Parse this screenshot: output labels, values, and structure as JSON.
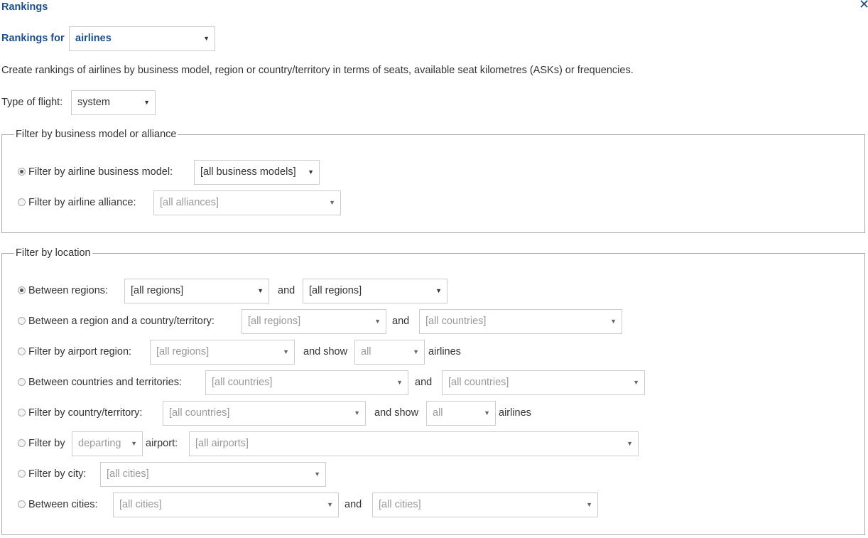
{
  "dialog": {
    "title": "Rankings",
    "close_glyph": "✕"
  },
  "rankings_for": {
    "label": "Rankings for",
    "value": "airlines"
  },
  "description": "Create rankings of airlines by business model, region or country/territory in terms of seats, available seat kilometres (ASKs) or frequencies.",
  "flight_type": {
    "label": "Type of flight:",
    "value": "system"
  },
  "business_filter": {
    "legend": "Filter by business model or alliance",
    "rows": [
      {
        "label": "Filter by airline business model:",
        "select": "[all business models]",
        "selected": true
      },
      {
        "label": "Filter by airline alliance:",
        "select": "[all alliances]",
        "selected": false
      }
    ]
  },
  "location_filter": {
    "legend": "Filter by location",
    "between_regions": {
      "label": "Between regions:",
      "select1": "[all regions]",
      "and": "and",
      "select2": "[all regions]",
      "selected": true
    },
    "region_country": {
      "label": "Between a region and a country/territory:",
      "select1": "[all regions]",
      "and": "and",
      "select2": "[all countries]"
    },
    "airport_region": {
      "label": "Filter by airport region:",
      "select1": "[all regions]",
      "and_show": "and show",
      "select2": "all",
      "suffix": "airlines"
    },
    "between_countries": {
      "label": "Between countries and territories:",
      "select1": "[all countries]",
      "and": "and",
      "select2": "[all countries]"
    },
    "country": {
      "label": "Filter by country/territory:",
      "select1": "[all countries]",
      "and_show": "and show",
      "select2": "all",
      "suffix": "airlines"
    },
    "airport": {
      "label": "Filter by",
      "direction": "departing",
      "airport_label": "airport:",
      "select": "[all airports]"
    },
    "city": {
      "label": "Filter by city:",
      "select": "[all cities]"
    },
    "between_cities": {
      "label": "Between cities:",
      "select1": "[all cities]",
      "and": "and",
      "select2": "[all cities]"
    }
  },
  "colors": {
    "accent": "#1b4f8c",
    "disabled_text": "#999999",
    "border": "#cccccc"
  }
}
